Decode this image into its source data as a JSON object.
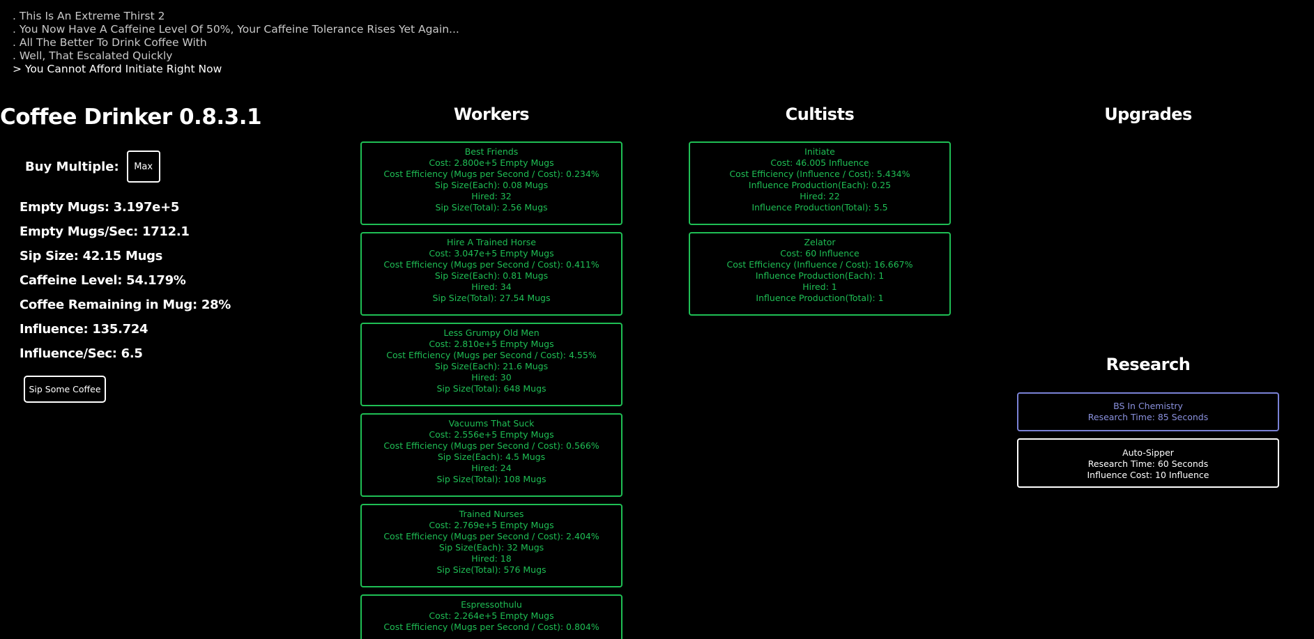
{
  "log": {
    "lines": [
      ". This Is An Extreme Thirst 2",
      ". You Now Have A Caffeine Level Of 50%, Your Caffeine Tolerance Rises Yet Again...",
      ". All The Better To Drink Coffee With",
      ". Well, That Escalated Quickly",
      "> You Cannot Afford Initiate Right Now"
    ]
  },
  "game": {
    "title": "Coffee Drinker 0.8.3.1",
    "buy_multiple_label": "Buy Multiple:",
    "buy_multiple_value": "Max",
    "sip_button": "Sip Some Coffee"
  },
  "stats": [
    "Empty Mugs: 3.197e+5",
    "Empty Mugs/Sec: 1712.1",
    "Sip Size: 42.15 Mugs",
    "Caffeine Level: 54.179%",
    "Coffee Remaining in Mug: 28%",
    "Influence: 135.724",
    "Influence/Sec: 6.5"
  ],
  "workers": {
    "heading": "Workers",
    "items": [
      {
        "name": "Best Friends",
        "cost": "Cost: 2.800e+5 Empty Mugs",
        "efficiency": "Cost Efficiency (Mugs per Second / Cost): 0.234%",
        "each": "Sip Size(Each): 0.08 Mugs",
        "hired": "Hired: 32",
        "total": "Sip Size(Total): 2.56 Mugs"
      },
      {
        "name": "Hire A Trained Horse",
        "cost": "Cost: 3.047e+5 Empty Mugs",
        "efficiency": "Cost Efficiency (Mugs per Second / Cost): 0.411%",
        "each": "Sip Size(Each): 0.81 Mugs",
        "hired": "Hired: 34",
        "total": "Sip Size(Total): 27.54 Mugs"
      },
      {
        "name": "Less Grumpy Old Men",
        "cost": "Cost: 2.810e+5 Empty Mugs",
        "efficiency": "Cost Efficiency (Mugs per Second / Cost): 4.55%",
        "each": "Sip Size(Each): 21.6 Mugs",
        "hired": "Hired: 30",
        "total": "Sip Size(Total): 648 Mugs"
      },
      {
        "name": "Vacuums That Suck",
        "cost": "Cost: 2.556e+5 Empty Mugs",
        "efficiency": "Cost Efficiency (Mugs per Second / Cost): 0.566%",
        "each": "Sip Size(Each): 4.5 Mugs",
        "hired": "Hired: 24",
        "total": "Sip Size(Total): 108 Mugs"
      },
      {
        "name": "Trained Nurses",
        "cost": "Cost: 2.769e+5 Empty Mugs",
        "efficiency": "Cost Efficiency (Mugs per Second / Cost): 2.404%",
        "each": "Sip Size(Each): 32 Mugs",
        "hired": "Hired: 18",
        "total": "Sip Size(Total): 576 Mugs"
      },
      {
        "name": "Espressothulu",
        "cost": "Cost: 2.264e+5 Empty Mugs",
        "efficiency": "Cost Efficiency (Mugs per Second / Cost): 0.804%"
      }
    ]
  },
  "cultists": {
    "heading": "Cultists",
    "items": [
      {
        "name": "Initiate",
        "cost": "Cost: 46.005 Influence",
        "efficiency": "Cost Efficiency (Influence / Cost): 5.434%",
        "each": "Influence Production(Each): 0.25",
        "hired": "Hired: 22",
        "total": "Influence Production(Total): 5.5"
      },
      {
        "name": "Zelator",
        "cost": "Cost: 60 Influence",
        "efficiency": "Cost Efficiency (Influence / Cost): 16.667%",
        "each": "Influence Production(Each): 1",
        "hired": "Hired: 1",
        "total": "Influence Production(Total): 1"
      }
    ]
  },
  "upgrades": {
    "heading": "Upgrades"
  },
  "research": {
    "heading": "Research",
    "items": [
      {
        "name": "BS In Chemistry",
        "time": "Research Time: 85 Seconds",
        "color": "#8a91de"
      },
      {
        "name": "Auto-Sipper",
        "time": "Research Time: 60 Seconds",
        "cost": "Influence Cost: 10 Influence",
        "color": "#ffffff"
      }
    ]
  },
  "colors": {
    "background": "#000000",
    "card_border": "#1fbf55",
    "card_text": "#1fbf55",
    "research_active_border": "#7a82d6"
  }
}
